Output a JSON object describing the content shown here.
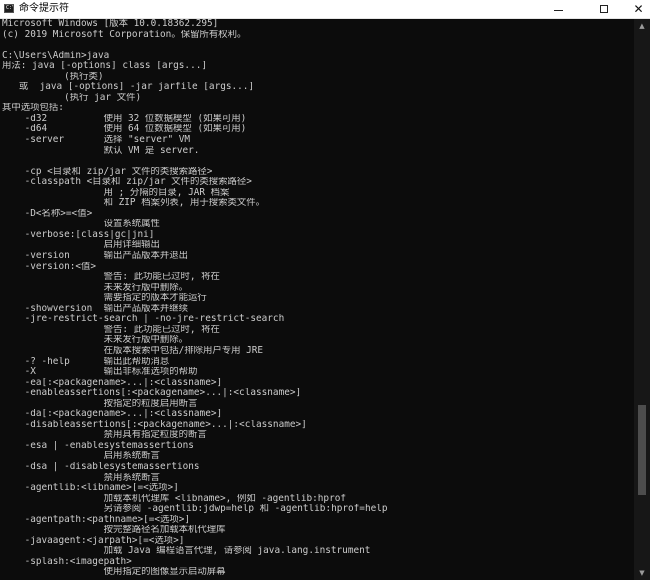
{
  "window": {
    "title": "命令提示符",
    "icon_label": "C:\\",
    "minimize_label": "minimize",
    "maximize_label": "maximize",
    "close_glyph": "✕"
  },
  "scroll": {
    "position_fraction": 0.84
  },
  "console": {
    "lines": [
      "Microsoft Windows [版本 10.0.18362.295]",
      "(c) 2019 Microsoft Corporation。保留所有权利。",
      "",
      "C:\\Users\\Admin>java",
      "用法: java [-options] class [args...]",
      "           (执行类)",
      "   或  java [-options] -jar jarfile [args...]",
      "           (执行 jar 文件)",
      "其中选项包括:",
      "    -d32          使用 32 位数据模型 (如果可用)",
      "    -d64          使用 64 位数据模型 (如果可用)",
      "    -server       选择 \"server\" VM",
      "                  默认 VM 是 server.",
      "",
      "    -cp <目录和 zip/jar 文件的类搜索路径>",
      "    -classpath <目录和 zip/jar 文件的类搜索路径>",
      "                  用 ; 分隔的目录, JAR 档案",
      "                  和 ZIP 档案列表, 用于搜索类文件。",
      "    -D<名称>=<值>",
      "                  设置系统属性",
      "    -verbose:[class|gc|jni]",
      "                  启用详细输出",
      "    -version      输出产品版本并退出",
      "    -version:<值>",
      "                  警告: 此功能已过时, 将在",
      "                  未来发行版中删除。",
      "                  需要指定的版本才能运行",
      "    -showversion  输出产品版本并继续",
      "    -jre-restrict-search | -no-jre-restrict-search",
      "                  警告: 此功能已过时, 将在",
      "                  未来发行版中删除。",
      "                  在版本搜索中包括/排除用户专用 JRE",
      "    -? -help      输出此帮助消息",
      "    -X            输出非标准选项的帮助",
      "    -ea[:<packagename>...|:<classname>]",
      "    -enableassertions[:<packagename>...|:<classname>]",
      "                  按指定的粒度启用断言",
      "    -da[:<packagename>...|:<classname>]",
      "    -disableassertions[:<packagename>...|:<classname>]",
      "                  禁用具有指定粒度的断言",
      "    -esa | -enablesystemassertions",
      "                  启用系统断言",
      "    -dsa | -disablesystemassertions",
      "                  禁用系统断言",
      "    -agentlib:<libname>[=<选项>]",
      "                  加载本机代理库 <libname>, 例如 -agentlib:hprof",
      "                  另请参阅 -agentlib:jdwp=help 和 -agentlib:hprof=help",
      "    -agentpath:<pathname>[=<选项>]",
      "                  按完整路径名加载本机代理库",
      "    -javaagent:<jarpath>[=<选项>]",
      "                  加载 Java 编程语言代理, 请参阅 java.lang.instrument",
      "    -splash:<imagepath>",
      "                  使用指定的图像显示启动屏幕"
    ]
  }
}
